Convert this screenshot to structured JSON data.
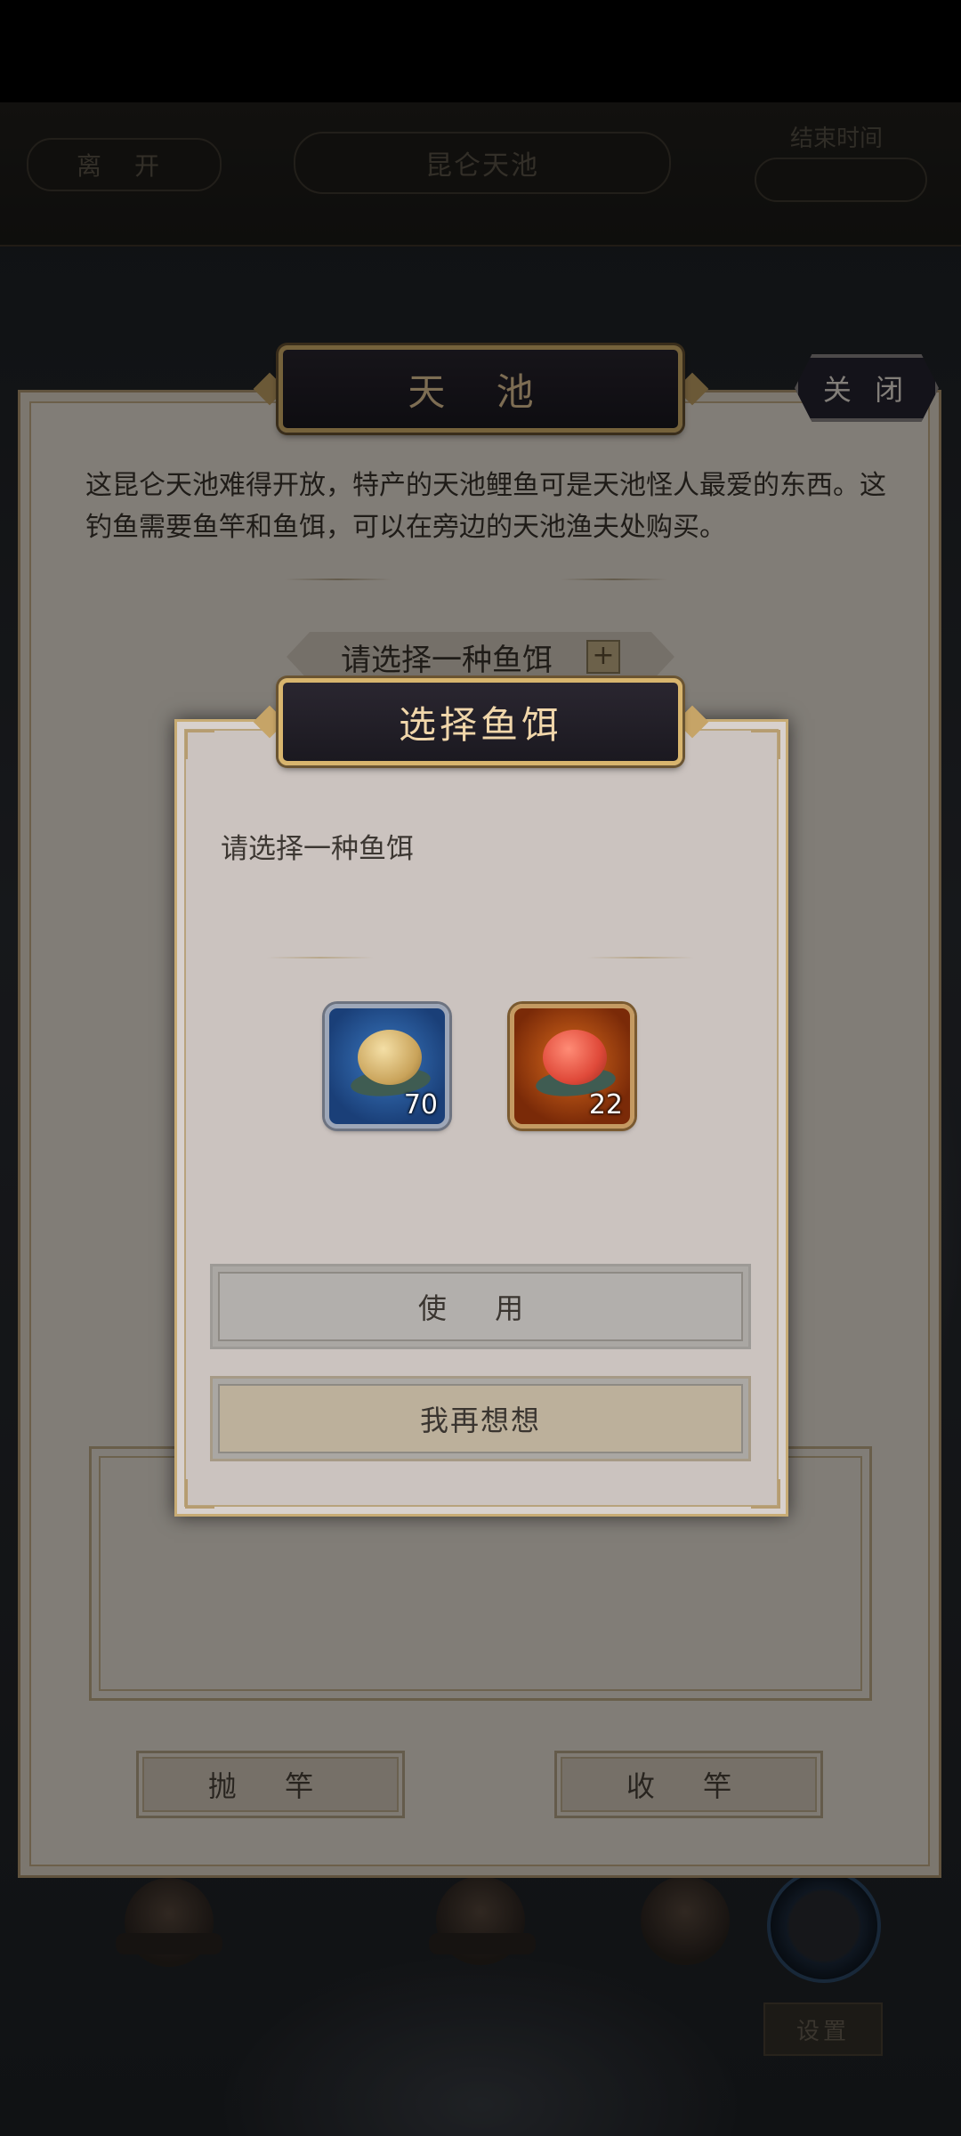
{
  "top_bar": {
    "leave_label": "离 开",
    "location_title": "昆仑天池",
    "end_time_label": "结束时间",
    "end_time_value": "",
    "notice_text": ""
  },
  "panel": {
    "title": "天 池",
    "close_label": "关 闭",
    "description": "这昆仑天池难得开放，特产的天池鲤鱼可是天池怪人最爱的东西。这钓鱼需要鱼竿和鱼饵，可以在旁边的天池渔夫处购买。",
    "bait_selector_label": "请选择一种鱼饵",
    "bait_selector_plus": "+",
    "cast_button": "抛 竿",
    "reel_button": "收 竿"
  },
  "dialog": {
    "title": "选择鱼饵",
    "prompt": "请选择一种鱼饵",
    "baits": [
      {
        "name": "normal-bait",
        "count": "70",
        "frame_color": "#3a78c0"
      },
      {
        "name": "special-bait",
        "count": "22",
        "frame_color": "#d96a1c"
      }
    ],
    "use_button": "使 用",
    "rethink_button": "我再想想"
  },
  "bottom": {
    "settings_label": "设置"
  },
  "colors": {
    "panel_bg": "#efe7dc",
    "dialog_bg": "#cbc3bf",
    "plaque_border": "#d8b56e",
    "plaque_text": "#f0d6aa"
  }
}
